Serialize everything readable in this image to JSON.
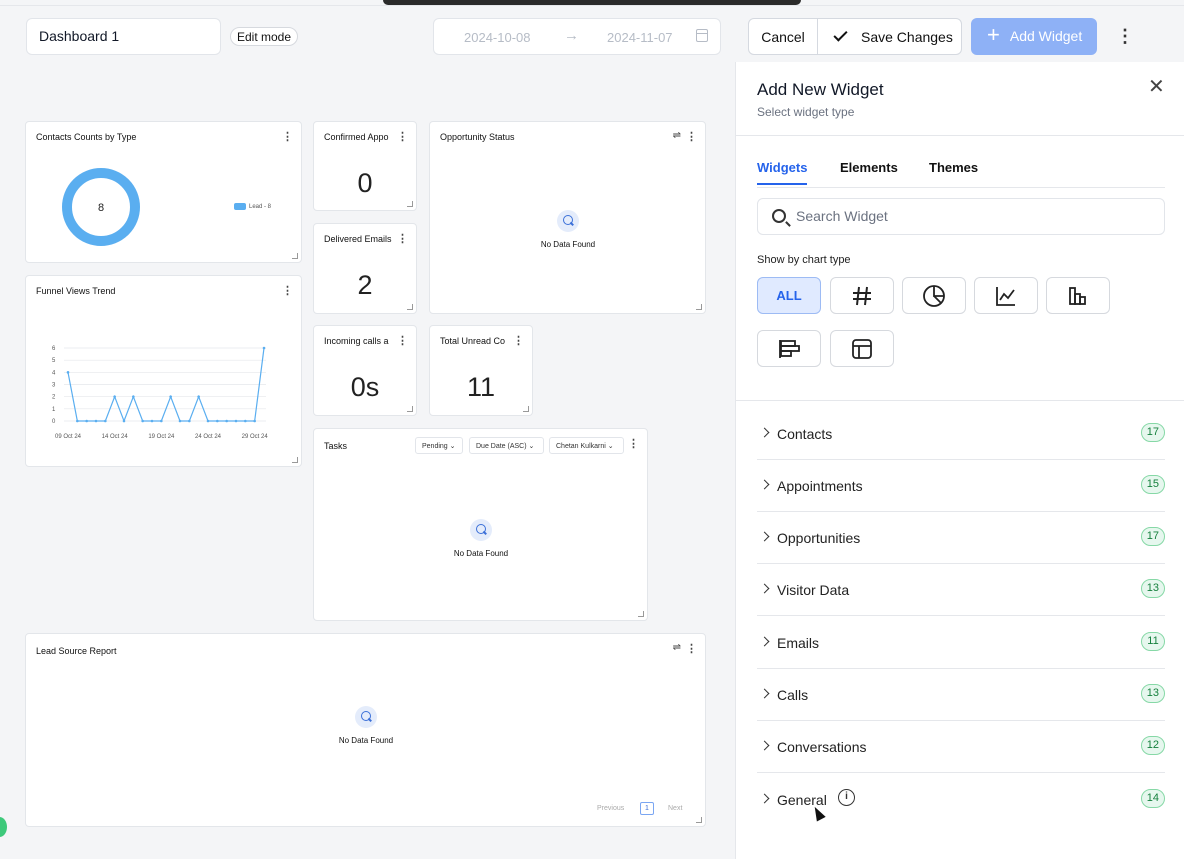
{
  "header": {
    "dashboard_name": "Dashboard 1",
    "mode_badge": "Edit mode",
    "date_start": "2024-10-08",
    "date_end": "2024-11-07",
    "cancel_label": "Cancel",
    "save_label": "Save Changes",
    "add_widget_label": "Add Widget"
  },
  "widgets": {
    "contacts_by_type": {
      "title": "Contacts Counts by Type",
      "center_value": "8",
      "legend": "Lead - 8"
    },
    "confirmed_appts": {
      "title": "Confirmed Appo",
      "value": "0"
    },
    "opportunity_status": {
      "title": "Opportunity Status",
      "empty": "No Data Found"
    },
    "delivered_emails": {
      "title": "Delivered Emails",
      "value": "2"
    },
    "funnel_views": {
      "title": "Funnel Views Trend"
    },
    "incoming_calls": {
      "title": "Incoming calls a",
      "value": "0s"
    },
    "total_unread": {
      "title": "Total Unread Co",
      "value": "11"
    },
    "tasks": {
      "title": "Tasks",
      "filter_status": "Pending",
      "filter_sort": "Due Date (ASC)",
      "filter_user": "Chetan Kulkarni",
      "empty": "No Data Found"
    },
    "lead_source": {
      "title": "Lead Source Report",
      "empty": "No Data Found",
      "prev": "Previous",
      "page": "1",
      "next": "Next"
    }
  },
  "chart_data": {
    "type": "line",
    "title": "Funnel Views Trend",
    "x": [
      "09 Oct 24",
      "10 Oct 24",
      "11 Oct 24",
      "12 Oct 24",
      "13 Oct 24",
      "14 Oct 24",
      "15 Oct 24",
      "16 Oct 24",
      "17 Oct 24",
      "18 Oct 24",
      "19 Oct 24",
      "20 Oct 24",
      "21 Oct 24",
      "22 Oct 24",
      "23 Oct 24",
      "24 Oct 24",
      "25 Oct 24",
      "26 Oct 24",
      "27 Oct 24",
      "28 Oct 24",
      "29 Oct 24",
      "30 Oct 24"
    ],
    "values": [
      4,
      0,
      0,
      0,
      0,
      2,
      0,
      2,
      0,
      0,
      0,
      2,
      0,
      0,
      2,
      0,
      0,
      0,
      0,
      0,
      0,
      6
    ],
    "x_tick_labels": [
      "09 Oct 24",
      "14 Oct 24",
      "19 Oct 24",
      "24 Oct 24",
      "29 Oct 24"
    ],
    "y_ticks": [
      0,
      1,
      2,
      3,
      4,
      5,
      6
    ],
    "ylim": [
      0,
      6
    ],
    "color": "#5aaef0"
  },
  "panel": {
    "title": "Add New Widget",
    "subtitle": "Select widget type",
    "tabs": [
      "Widgets",
      "Elements",
      "Themes"
    ],
    "search_placeholder": "Search Widget",
    "show_by_label": "Show by chart type",
    "chart_types": [
      {
        "label": "ALL",
        "icon": "all"
      },
      {
        "label": "",
        "icon": "hash-icon"
      },
      {
        "label": "",
        "icon": "pie-chart-icon"
      },
      {
        "label": "",
        "icon": "line-chart-icon"
      },
      {
        "label": "",
        "icon": "bar-chart-icon"
      },
      {
        "label": "",
        "icon": "horizontal-bar-icon"
      },
      {
        "label": "",
        "icon": "table-icon"
      }
    ],
    "categories": [
      {
        "label": "Contacts",
        "count": "17"
      },
      {
        "label": "Appointments",
        "count": "15"
      },
      {
        "label": "Opportunities",
        "count": "17"
      },
      {
        "label": "Visitor Data",
        "count": "13"
      },
      {
        "label": "Emails",
        "count": "11"
      },
      {
        "label": "Calls",
        "count": "13"
      },
      {
        "label": "Conversations",
        "count": "12"
      },
      {
        "label": "General",
        "count": "14"
      }
    ]
  },
  "colors": {
    "accent": "#2563eb",
    "add_widget_bg": "#8eb1f6",
    "badge_green": "#15803d",
    "chart_line": "#5aaef0"
  }
}
